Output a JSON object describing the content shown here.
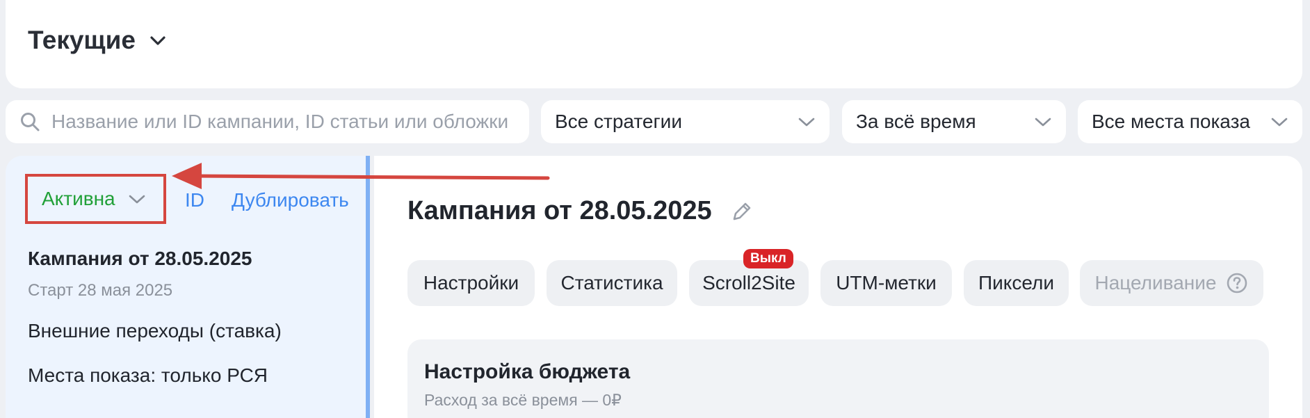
{
  "header": {
    "title": "Текущие"
  },
  "filters": {
    "search_placeholder": "Название или ID кампании, ID статьи или обложки",
    "strategy": "Все стратегии",
    "period": "За всё время",
    "places": "Все места показа"
  },
  "sidebar": {
    "status": "Активна",
    "id_link": "ID",
    "duplicate_link": "Дублировать",
    "campaign_name": "Кампания от 28.05.2025",
    "start": "Старт 28 мая 2025",
    "goal": "Внешние переходы (ставка)",
    "places": "Места показа: только РСЯ"
  },
  "main": {
    "title": "Кампания от 28.05.2025",
    "tabs": [
      {
        "label": "Настройки"
      },
      {
        "label": "Статистика"
      },
      {
        "label": "Scroll2Site",
        "badge": "Выкл"
      },
      {
        "label": "UTM-метки"
      },
      {
        "label": "Пиксели"
      },
      {
        "label": "Нацеливание",
        "disabled": true
      }
    ],
    "budget": {
      "title": "Настройка бюджета",
      "spent": "Расход за всё время — 0₽"
    }
  },
  "colors": {
    "status_active": "#21a038",
    "link": "#3d87f0",
    "annotation": "#d5463f",
    "badge": "#d92427"
  }
}
